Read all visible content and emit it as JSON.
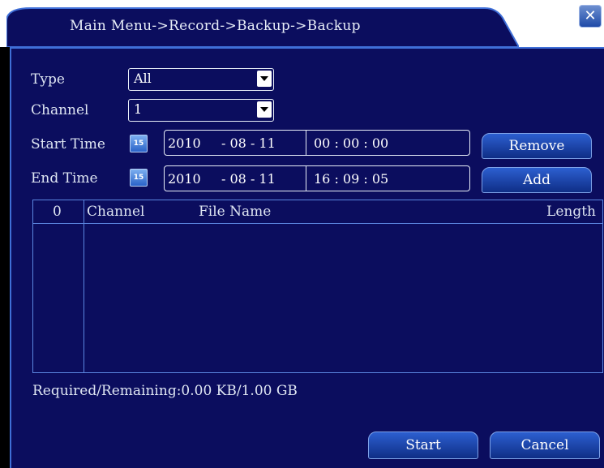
{
  "window": {
    "title": "Main Menu->Record->Backup->Backup",
    "close_glyph": "✕"
  },
  "form": {
    "type_label": "Type",
    "type_value": "All",
    "channel_label": "Channel",
    "channel_value": "1",
    "start_time_label": "Start Time",
    "end_time_label": "End Time",
    "calendar_icon_text": "15",
    "start": {
      "date_year": "2010",
      "date_sep1": "- 08 - 11",
      "time": "00 : 00 : 00"
    },
    "end": {
      "date_year": "2010",
      "date_sep1": "- 08 - 11",
      "time": "16 : 09 : 05"
    }
  },
  "buttons": {
    "remove": "Remove",
    "add": "Add",
    "start": "Start",
    "cancel": "Cancel"
  },
  "file_list": {
    "columns": [
      "0",
      "Channel",
      "File Name",
      "Length"
    ],
    "rows": []
  },
  "status": {
    "required_remaining": "Required/Remaining:0.00 KB/1.00 GB"
  },
  "colors": {
    "panel_bg": "#0b0d5e",
    "accent_border": "#3f6fd8",
    "button_top": "#2c5fd0",
    "button_bottom": "#0f2e86"
  }
}
